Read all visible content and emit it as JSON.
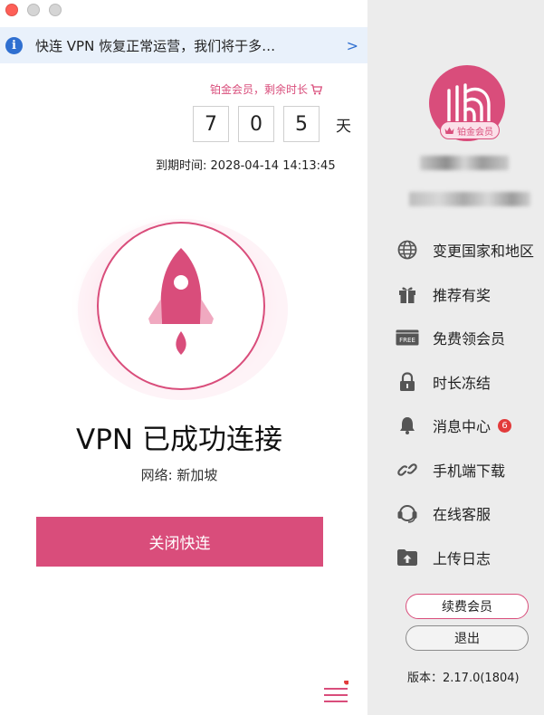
{
  "window": {
    "controls": [
      "close",
      "minimize",
      "zoom"
    ],
    "colors": {
      "close": "#fe5f57",
      "minimize": "#d5d5d5",
      "zoom": "#d5d5d5"
    }
  },
  "notice": {
    "icon": "info-icon",
    "text": "快连 VPN 恢复正常运营，我们将于多…",
    "arrow": ">"
  },
  "plan": {
    "label": "铂金会员，剩余时长",
    "cart_icon": "cart-icon",
    "days_digits": [
      "7",
      "0",
      "5"
    ],
    "unit": "天",
    "expiry_label": "到期时间:",
    "expiry_value": "2028-04-14 14:13:45"
  },
  "connection": {
    "icon": "rocket-icon",
    "status": "VPN 已成功连接",
    "network_label": "网络:",
    "network_value": "新加坡",
    "button": "关闭快连"
  },
  "footer": {
    "menu_icon": "hamburger-menu-icon",
    "has_notification_dot": true
  },
  "sidebar": {
    "avatar_badge": "铂金会员",
    "menu": [
      {
        "label": "变更国家和地区",
        "icon": "globe-icon"
      },
      {
        "label": "推荐有奖",
        "icon": "gift-icon"
      },
      {
        "label": "免费领会员",
        "icon": "free-ticket-icon"
      },
      {
        "label": "时长冻结",
        "icon": "lock-icon"
      },
      {
        "label": "消息中心",
        "icon": "bell-icon",
        "badge": "6"
      },
      {
        "label": "手机端下载",
        "icon": "link-icon"
      },
      {
        "label": "在线客服",
        "icon": "headset-icon"
      },
      {
        "label": "上传日志",
        "icon": "upload-folder-icon"
      }
    ],
    "renew_button": "续费会员",
    "logout_button": "退出",
    "version": "版本：2.17.0(1804)"
  },
  "colors": {
    "accent": "#d94d7b",
    "info": "#2f6fd0",
    "sidebar_bg": "#ececec",
    "badge_red": "#e23b3b"
  }
}
